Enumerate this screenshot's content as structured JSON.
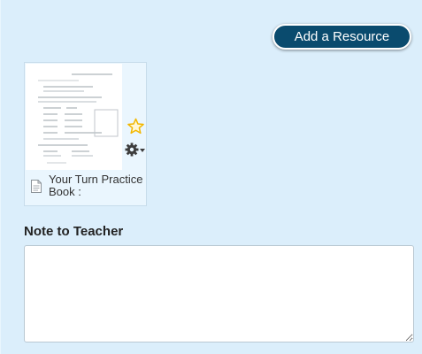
{
  "toolbar": {
    "add_resource_label": "Add a Resource"
  },
  "resource_card": {
    "title": "Your Turn Practice Book :",
    "icons": {
      "favorite": "star-icon",
      "settings": "gear-icon",
      "menu_caret": "chevron-down-icon",
      "type": "document-icon"
    }
  },
  "note": {
    "label": "Note to Teacher",
    "value": "",
    "placeholder": ""
  },
  "colors": {
    "background": "#dbeefb",
    "button_bg": "#0a4b6e",
    "button_text": "#ffffff",
    "star": "#f2b700"
  }
}
